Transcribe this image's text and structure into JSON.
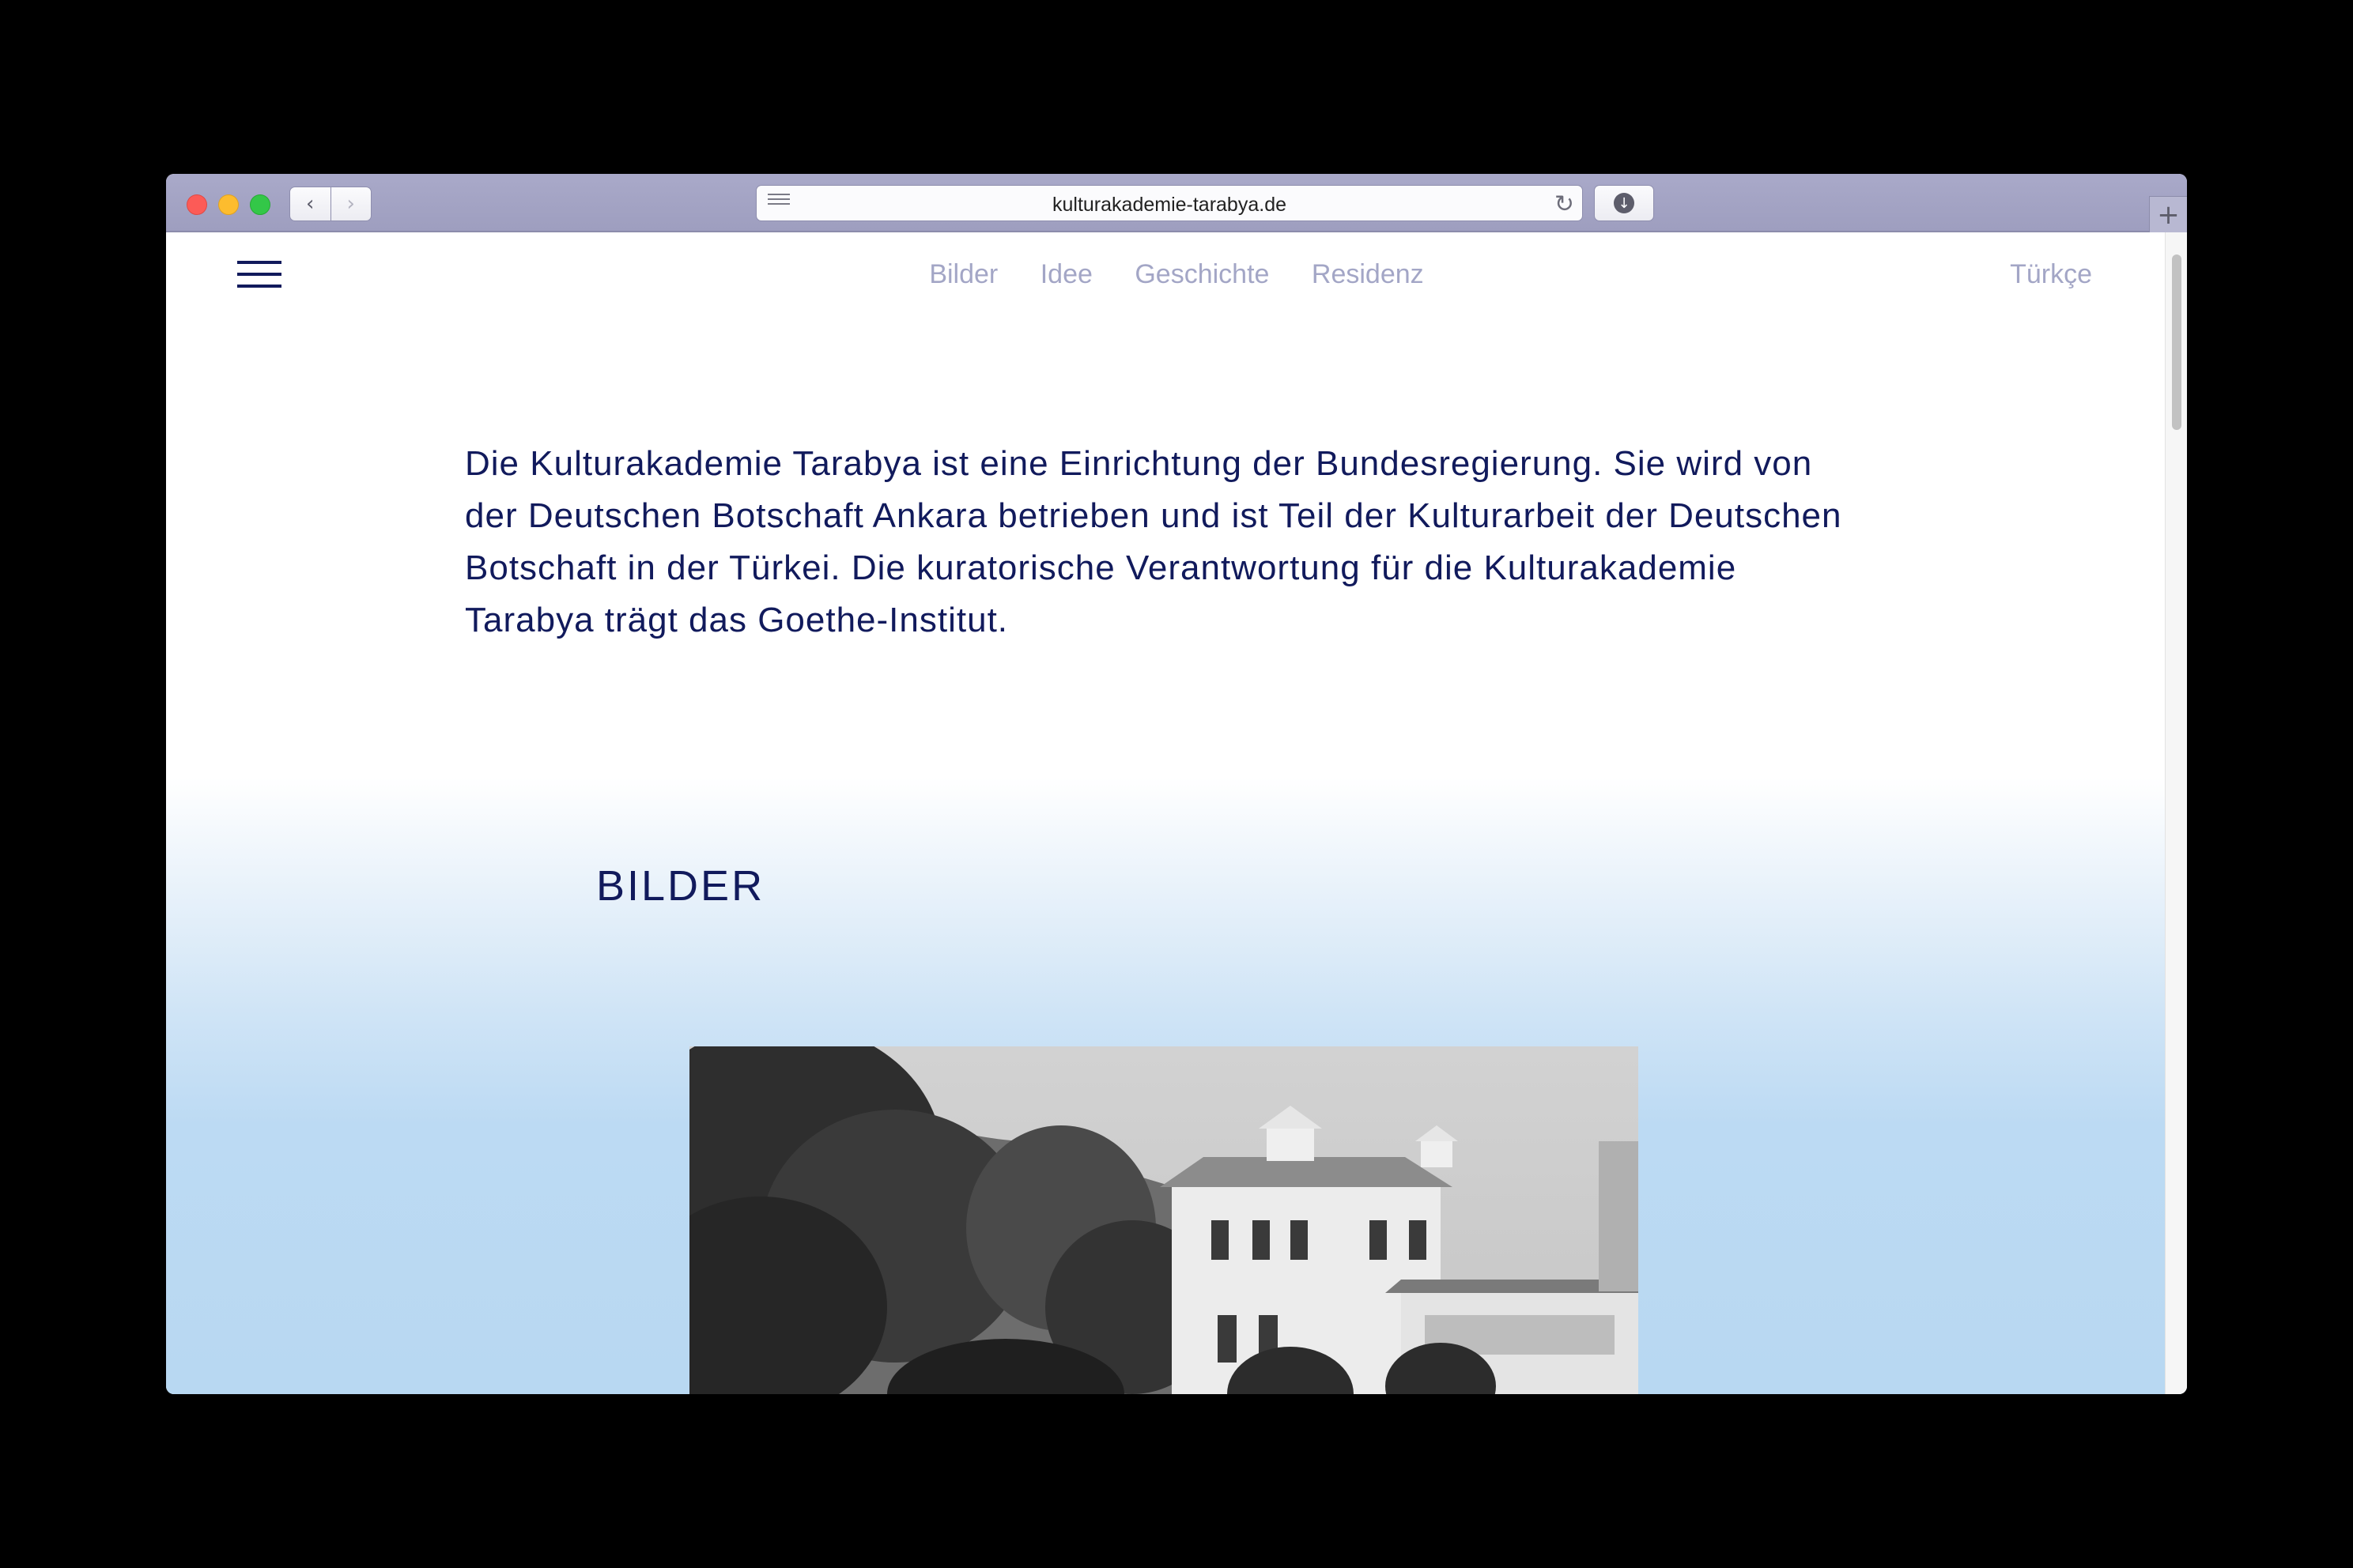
{
  "browser": {
    "url": "kulturakademie-tarabya.de",
    "back_icon": "‹",
    "forward_icon": "›",
    "reload_icon": "↻",
    "download_icon": "↓",
    "newtab_icon": "+"
  },
  "nav": {
    "items": [
      "Bilder",
      "Idee",
      "Geschichte",
      "Residenz"
    ],
    "language": "Türkçe"
  },
  "intro": {
    "text": "Die Kulturakademie Tarabya ist eine Einrichtung der Bundesregierung. Sie wird von der Deutschen Botschaft Ankara betrieben und ist Teil der Kulturarbeit der Deutschen Botschaft in der Türkei. Die kuratorische Verantwortung für die Kulturakademie Tarabya trägt das Goethe-Institut."
  },
  "section": {
    "title": "BILDER"
  },
  "colors": {
    "accent_navy": "#111a5c",
    "nav_muted": "#a3a6c6",
    "background_blue": "#b8d8f2",
    "chrome_lavender": "#a9a9c9"
  }
}
